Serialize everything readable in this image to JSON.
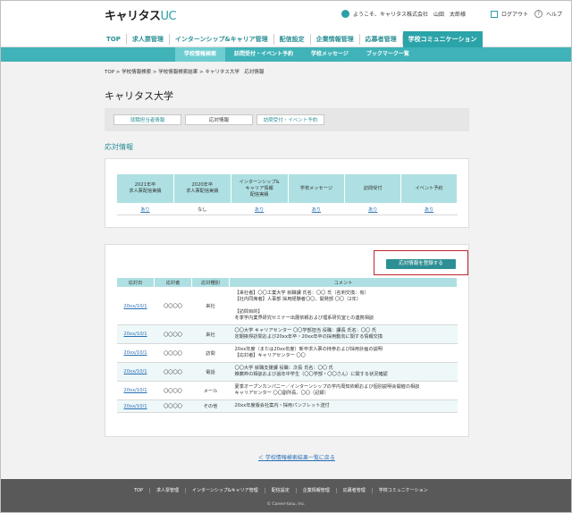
{
  "header": {
    "logo_main": "キャリタス",
    "logo_sub": "UC",
    "greeting": "ようこそ、キャリタス株式会社　山田　太郎様",
    "logout": "ログアウト",
    "help": "ヘルプ"
  },
  "main_nav": [
    {
      "label": "TOP"
    },
    {
      "label": "求人票管理"
    },
    {
      "label": "インターンシップ&キャリア管理"
    },
    {
      "label": "配信設定"
    },
    {
      "label": "企業情報管理"
    },
    {
      "label": "応募者管理"
    },
    {
      "label": "学校コミュニケーション"
    }
  ],
  "sub_nav": [
    {
      "label": "学校情報検索"
    },
    {
      "label": "訪問受付・イベント予約"
    },
    {
      "label": "学校メッセージ"
    },
    {
      "label": "ブックマーク一覧"
    }
  ],
  "breadcrumb": "TOP > 学校情報検索 > 学校情報検索結果 > キャリタス大学　応対情報",
  "page_title": "キャリタス大学",
  "tabs": [
    {
      "label": "就職担当者情報"
    },
    {
      "label": "応対情報"
    },
    {
      "label": "訪問受付・イベント予約"
    }
  ],
  "section_title": "応対情報",
  "summary": {
    "headers": [
      "2021年卒\n求人票配信実績",
      "2020年卒\n求人票配信実績",
      "インターンシップ&\nキャリア情報\n配信実績",
      "学校メッセージ",
      "訪問受付",
      "イベント予約"
    ],
    "values": [
      "あり",
      "なし",
      "あり",
      "あり",
      "あり",
      "あり"
    ]
  },
  "register_button": "応対情報を登録する",
  "comm_table": {
    "headers": [
      "応対日",
      "応対者",
      "応対種別",
      "コメント"
    ],
    "rows": [
      {
        "date": "20xx/10/1",
        "person": "〇〇〇〇",
        "type": "来社",
        "comment": "【来社者】〇〇工業大学 就職課 氏名：〇〇 氏（名刺交換：有）\n【社内同席者】人事部 採用経験者〇〇、開発部 〇〇（2年）\n\n【訪問目的】\n冬季学内業界研究セミナー出展依頼および理系研究室との連携相談"
      },
      {
        "date": "20xx/10/1",
        "person": "〇〇〇〇",
        "type": "来社",
        "comment": "〇〇大学 キャリアセンター 〇〇学部担当 役職：課長 氏名：〇〇 氏\n定期挨拶訪問および20xx年卒・20xx年卒の採用動向に関する情報交換"
      },
      {
        "date": "20xx/10/1",
        "person": "〇〇〇〇",
        "type": "訪問",
        "comment": "20xx年度（または20xx年度）新卒求人票の持参および採用計画の説明\n【応対者】キャリアセンター 〇〇"
      },
      {
        "date": "20xx/10/1",
        "person": "〇〇〇〇",
        "type": "電話",
        "comment": "〇〇大学 就職支援課 役職：次長 氏名：〇〇 氏\n推薦枠の相談および過年中学生（〇〇学部・〇〇さん）に関する状況確認"
      },
      {
        "date": "20xx/10/1",
        "person": "〇〇〇〇",
        "type": "メール",
        "comment": "夏季オープンカンパニー／インターンシップの学内周知依頼および個別説明会開催の相談\nキャリアセンター 〇〇副所長、〇〇（記録）"
      },
      {
        "date": "20xx/10/1",
        "person": "〇〇〇〇",
        "type": "その他",
        "comment": "20xx年度版会社案内・採用パンフレット送付"
      }
    ]
  },
  "back_link": "＜ 学校情報検索結果一覧に戻る",
  "footer": {
    "links": [
      "TOP",
      "求人票管理",
      "インターンシップ&キャリア管理",
      "配信設定",
      "企業情報管理",
      "応募者管理",
      "学校コミュニケーション"
    ],
    "copyright": "© Career-tasu, Inc."
  },
  "colors": {
    "accent": "#2aa3a9",
    "subnav": "#3fb3b8",
    "table_header": "#aee0e3",
    "highlight_border": "#c0262d",
    "footer": "#595959"
  }
}
